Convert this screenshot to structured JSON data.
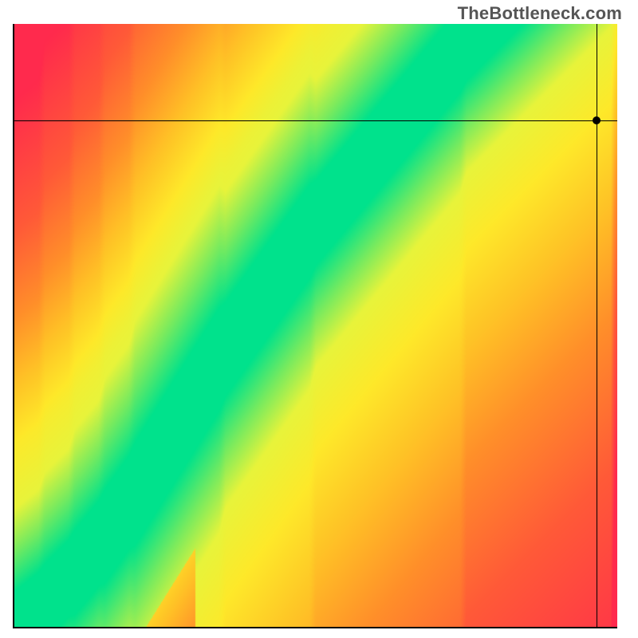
{
  "brand": "TheBottleneck.com",
  "chart_data": {
    "type": "heatmap",
    "title": "",
    "xlabel": "",
    "ylabel": "",
    "x_range": [
      0,
      1
    ],
    "y_range": [
      0,
      1
    ],
    "axes_visible": {
      "left": true,
      "bottom": true,
      "top": false,
      "right": false
    },
    "grid": false,
    "tick_labels": [],
    "marker": {
      "x": 0.965,
      "y": 0.84
    },
    "crosshair": {
      "x": 0.965,
      "y": 0.84
    },
    "ideal_ridge": [
      {
        "x": 0.0,
        "y": 0.0
      },
      {
        "x": 0.05,
        "y": 0.04
      },
      {
        "x": 0.1,
        "y": 0.09
      },
      {
        "x": 0.15,
        "y": 0.15
      },
      {
        "x": 0.2,
        "y": 0.22
      },
      {
        "x": 0.25,
        "y": 0.3
      },
      {
        "x": 0.3,
        "y": 0.38
      },
      {
        "x": 0.35,
        "y": 0.46
      },
      {
        "x": 0.4,
        "y": 0.53
      },
      {
        "x": 0.45,
        "y": 0.6
      },
      {
        "x": 0.5,
        "y": 0.67
      },
      {
        "x": 0.55,
        "y": 0.73
      },
      {
        "x": 0.6,
        "y": 0.79
      },
      {
        "x": 0.65,
        "y": 0.85
      },
      {
        "x": 0.7,
        "y": 0.91
      },
      {
        "x": 0.75,
        "y": 0.97
      },
      {
        "x": 0.78,
        "y": 1.0
      }
    ],
    "ridge_half_width": 0.045,
    "color_scale": {
      "description": "green at ridge, through yellow/orange, to red at extremes",
      "stops": [
        {
          "d": 0.0,
          "color": "#00E28C"
        },
        {
          "d": 0.06,
          "color": "#78EB5F"
        },
        {
          "d": 0.12,
          "color": "#E8F43B"
        },
        {
          "d": 0.22,
          "color": "#FEE92A"
        },
        {
          "d": 0.35,
          "color": "#FFC226"
        },
        {
          "d": 0.5,
          "color": "#FF8F2A"
        },
        {
          "d": 0.7,
          "color": "#FF5A38"
        },
        {
          "d": 1.0,
          "color": "#FF2A4D"
        }
      ]
    }
  }
}
